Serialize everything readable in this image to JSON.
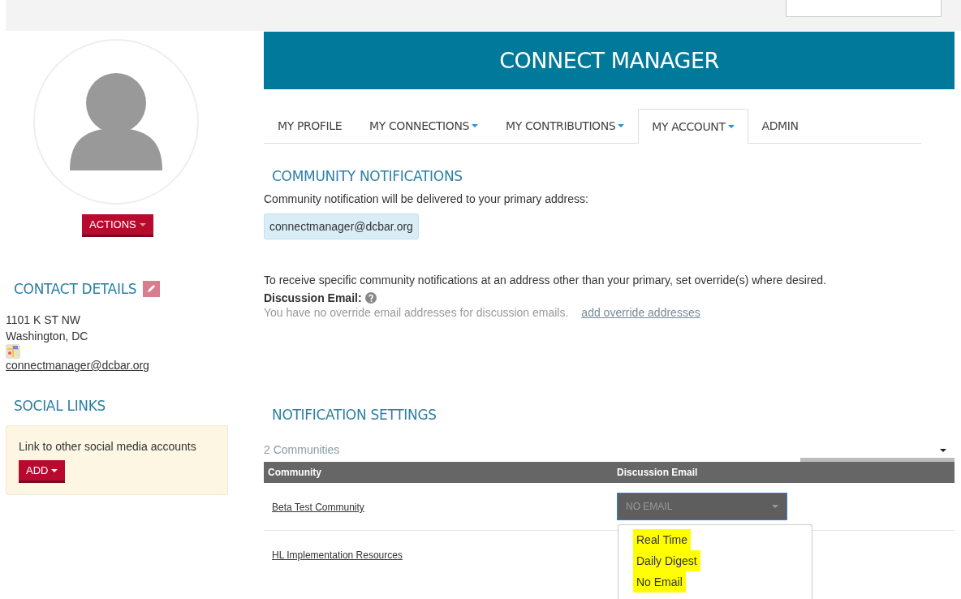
{
  "header": {
    "title": "CONNECT MANAGER"
  },
  "profile": {
    "actions_label": "ACTIONS"
  },
  "contact": {
    "heading": "CONTACT DETAILS",
    "address_lines": [
      "1101 K ST NW",
      "Washington, DC"
    ],
    "email": "connectmanager@dcbar.org"
  },
  "social": {
    "heading": "SOCIAL LINKS",
    "text": "Link to other social media accounts",
    "add_label": "ADD"
  },
  "tabs": [
    {
      "label": "MY PROFILE",
      "selected": false,
      "dropdown": false
    },
    {
      "label": "MY CONNECTIONS",
      "selected": false,
      "dropdown": true
    },
    {
      "label": "MY CONTRIBUTIONS",
      "selected": false,
      "dropdown": true
    },
    {
      "label": "MY ACCOUNT",
      "selected": true,
      "dropdown": true
    },
    {
      "label": "ADMIN",
      "selected": false,
      "dropdown": false
    }
  ],
  "community_notifications": {
    "heading": "COMMUNITY NOTIFICATIONS",
    "intro": "Community notification will be delivered to your primary address:",
    "primary_email": "connectmanager@dcbar.org",
    "override_text": "To receive specific community notifications at an address other than your primary, set override(s) where desired.",
    "discussion_label": "Discussion Email:",
    "no_override_text": "You have no override email addresses for discussion emails.",
    "add_override_link": "add override addresses"
  },
  "notification_settings": {
    "heading": "NOTIFICATION SETTINGS",
    "count": "2 Communities",
    "columns": [
      "Community",
      "Discussion Email"
    ],
    "rows": [
      {
        "community": "Beta Test Community",
        "select_value": "NO EMAIL"
      },
      {
        "community": "HL Implementation Resources"
      }
    ],
    "dropdown_options": [
      {
        "label": "Real Time",
        "highlighted": true
      },
      {
        "label": "Daily Digest",
        "highlighted": true
      },
      {
        "label": "No Email",
        "highlighted": true
      }
    ]
  }
}
